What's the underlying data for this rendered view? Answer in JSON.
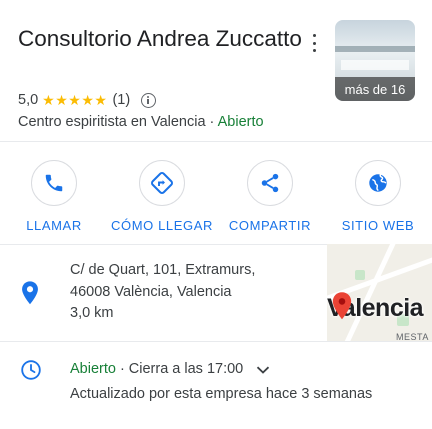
{
  "business": {
    "name": "Consultorio Andrea Zuccatto",
    "rating": "5,0",
    "stars": "★★★★★",
    "review_count": "(1)",
    "category": "Centro espiritista en Valencia",
    "separator": " · ",
    "status": "Abierto",
    "photos_label": "más de 16"
  },
  "actions": [
    {
      "label": "LLAMAR",
      "icon": "phone-icon"
    },
    {
      "label": "CÓMO LLEGAR",
      "icon": "directions-icon"
    },
    {
      "label": "COMPARTIR",
      "icon": "share-icon"
    },
    {
      "label": "SITIO WEB",
      "icon": "globe-icon"
    }
  ],
  "address": {
    "line1": "C/ de Quart, 101, Extramurs,",
    "line2": "46008 València, Valencia",
    "distance": "3,0 km"
  },
  "map": {
    "city_label": "Valencia",
    "district_label": "MESTA"
  },
  "hours": {
    "status": "Abierto",
    "separator": "·",
    "closes": "Cierra a las 17:00",
    "updated": "Actualizado por esta empresa hace 3 semanas"
  },
  "colors": {
    "accent": "#1a73e8",
    "open": "#188038",
    "star": "#fbbc04",
    "pin": "#ea4335"
  }
}
